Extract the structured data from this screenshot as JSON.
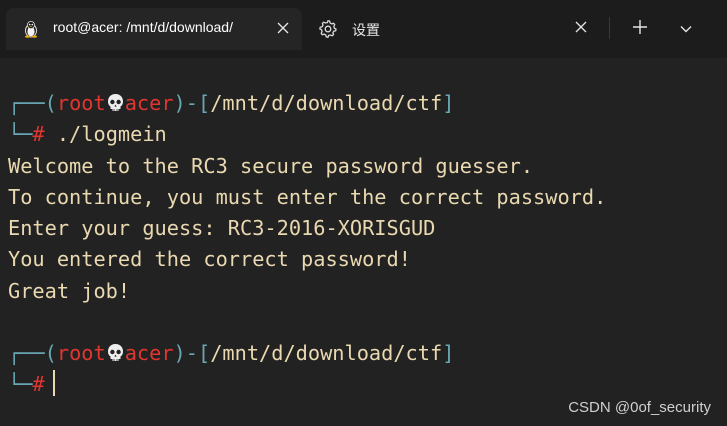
{
  "tabs": [
    {
      "title": "root@acer: /mnt/d/download/",
      "icon": "linux-penguin-icon",
      "active": true
    },
    {
      "title": "设置",
      "icon": "gear-icon",
      "active": false
    }
  ],
  "prompt1": {
    "open": "(",
    "user": "root",
    "host": "acer",
    "close": ")-[",
    "path": "/mnt/d/download/ctf",
    "end": "]",
    "symbol": "#",
    "command": " ./logmein"
  },
  "output": [
    "Welcome to the RC3 secure password guesser.",
    "To continue, you must enter the correct password.",
    "Enter your guess: RC3-2016-XORISGUD",
    "You entered the correct password!",
    "Great job!"
  ],
  "prompt2": {
    "open": "(",
    "user": "root",
    "host": "acer",
    "close": ")-[",
    "path": "/mnt/d/download/ctf",
    "end": "]",
    "symbol": "#"
  },
  "watermark": "CSDN @0of_security",
  "colors": {
    "background": "#222222",
    "tabbar": "#1c1c1c",
    "text": "#e9d8b0",
    "prompt_box": "#6aa7b4",
    "prompt_user": "#e0362f"
  }
}
